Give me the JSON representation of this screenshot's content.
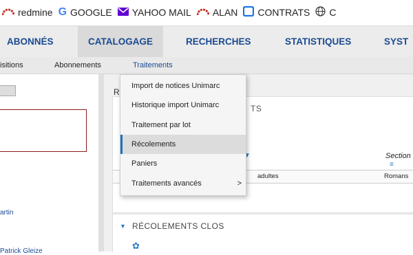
{
  "bookmarks": [
    {
      "label": "redmine",
      "icon": "redmine-icon",
      "color": "#c0392b"
    },
    {
      "label": "GOOGLE",
      "icon": "google-icon",
      "color": "#4285f4"
    },
    {
      "label": "YAHOO MAIL",
      "icon": "mail-icon",
      "color": "#6001d2"
    },
    {
      "label": "ALAN",
      "icon": "redmine-icon",
      "color": "#c0392b"
    },
    {
      "label": "CONTRATS",
      "icon": "folder-icon",
      "color": "#1a73e8"
    },
    {
      "label": "C",
      "icon": "globe-icon",
      "color": "#333333"
    }
  ],
  "topnav": {
    "tabs": [
      "ABONNÉS",
      "CATALOGAGE",
      "RECHERCHES",
      "STATISTIQUES",
      "SYST"
    ],
    "active": "CATALOGAGE"
  },
  "subnav": {
    "items": [
      "isitions",
      "Abonnements",
      "Traitements"
    ],
    "active": "Traitements"
  },
  "dropdown": {
    "items": [
      "Import de notices Unimarc",
      "Historique import Unimarc",
      "Traitement par lot",
      "Récolements",
      "Paniers",
      "Traitements avancés"
    ],
    "active": "Récolements",
    "submenu_arrow": ">"
  },
  "leftpanel": {
    "links": [
      "artin",
      "Patrick Gleize"
    ]
  },
  "main": {
    "r_label": "R",
    "panel1_title_fragment": "TS",
    "column_section": "Section",
    "row": {
      "col_a": "adultes",
      "col_b": "Romans"
    },
    "panel2_title": "RÉCOLEMENTS CLOS"
  }
}
